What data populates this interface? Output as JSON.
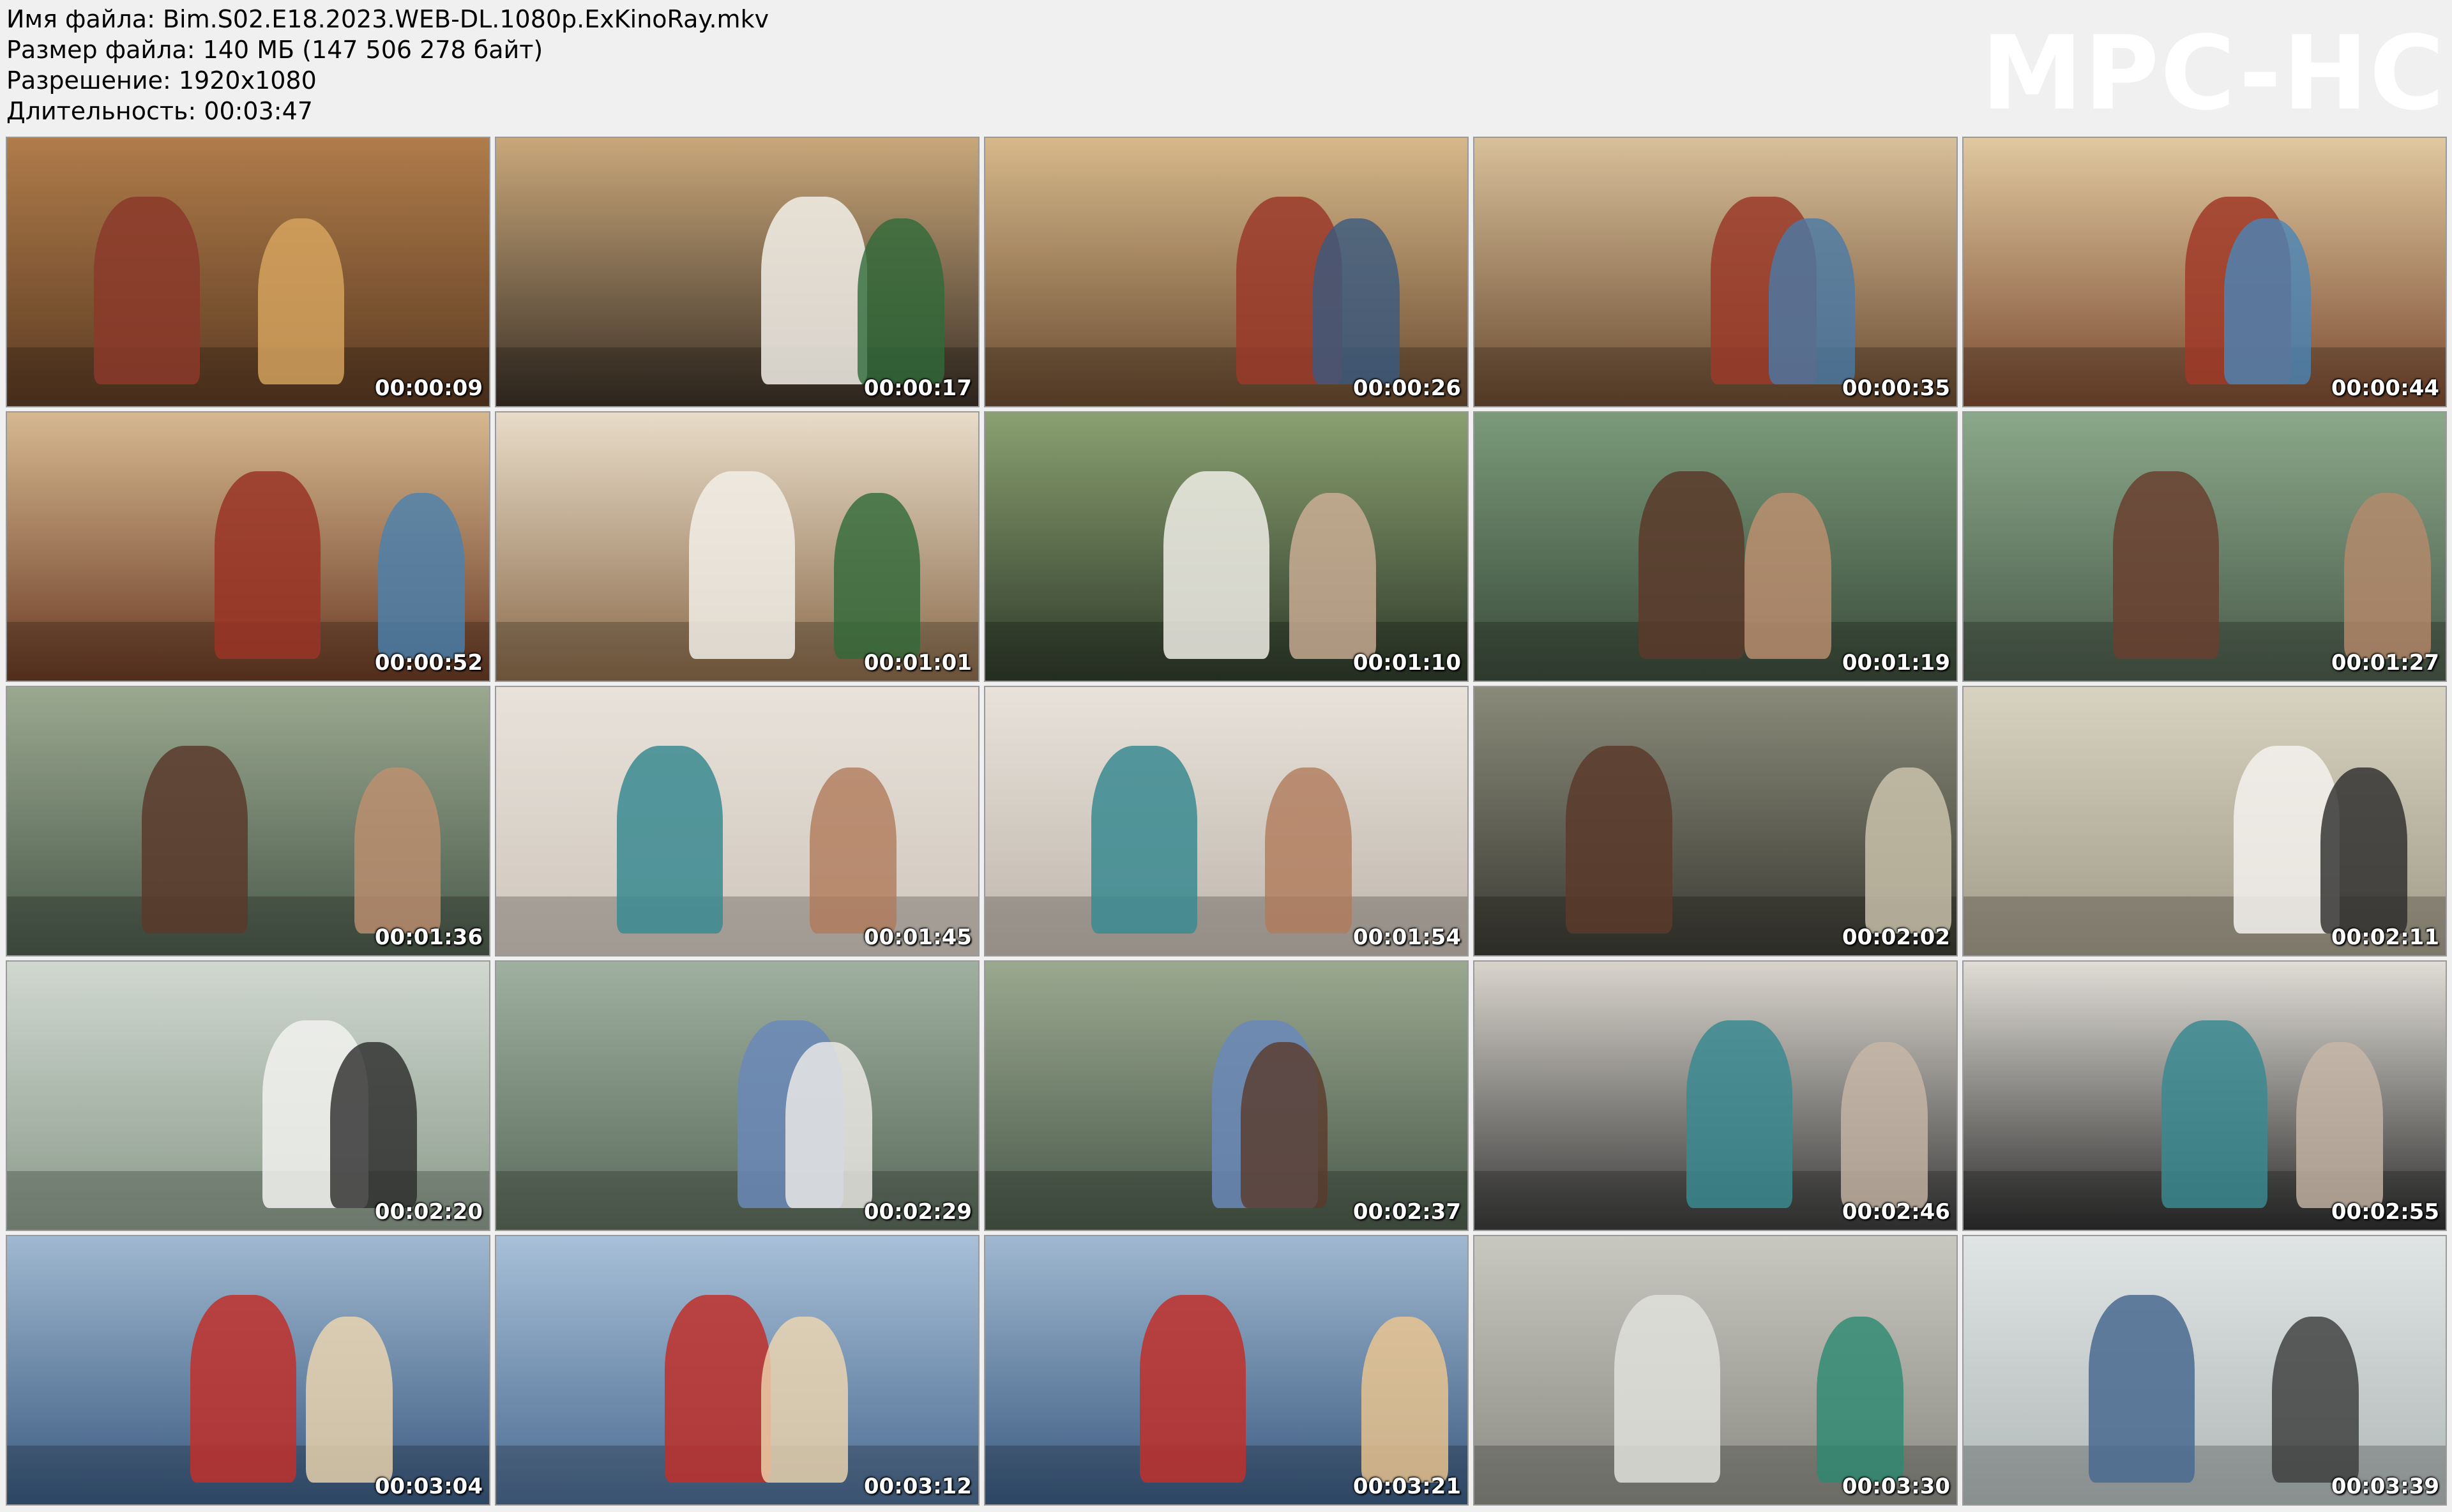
{
  "info": {
    "filename": "Имя файла: Bim.S02.E18.2023.WEB-DL.1080p.ExKinoRay.mkv",
    "filesize": "Размер файла: 140 МБ (147 506 278 байт)",
    "resolution": "Разрешение: 1920x1080",
    "duration": "Длительность: 00:03:47"
  },
  "brand": "MPC-HC",
  "thumbnails": [
    {
      "time": "00:00:09",
      "palette": [
        "#5a3a22",
        "#b07c4a",
        "#8b3a2a",
        "#d9a860"
      ]
    },
    {
      "time": "00:00:17",
      "palette": [
        "#3a3026",
        "#c9a77a",
        "#f2eee8",
        "#2f6a3a"
      ]
    },
    {
      "time": "00:00:26",
      "palette": [
        "#6a4a30",
        "#d6b88a",
        "#9a3a2a",
        "#3a5a80"
      ]
    },
    {
      "time": "00:00:35",
      "palette": [
        "#6a4a30",
        "#d8c09a",
        "#9a3a2a",
        "#4a7aa8"
      ]
    },
    {
      "time": "00:00:44",
      "palette": [
        "#7a4a30",
        "#e0c8a0",
        "#a03a28",
        "#4a86b8"
      ]
    },
    {
      "time": "00:00:52",
      "palette": [
        "#6a3a24",
        "#d6b890",
        "#9a3426",
        "#4a82b0"
      ]
    },
    {
      "time": "00:01:01",
      "palette": [
        "#8a6a4a",
        "#e8dcc8",
        "#f2efe8",
        "#2f6a3a"
      ]
    },
    {
      "time": "00:01:10",
      "palette": [
        "#2e3a2a",
        "#8aa070",
        "#f0ede6",
        "#d0b098"
      ]
    },
    {
      "time": "00:01:19",
      "palette": [
        "#3a4a3a",
        "#7a9a7a",
        "#5a3a2a",
        "#c09070"
      ]
    },
    {
      "time": "00:01:27",
      "palette": [
        "#4a5a4a",
        "#8aa88a",
        "#6a4030",
        "#b88a6a"
      ]
    },
    {
      "time": "00:01:36",
      "palette": [
        "#4a5a4a",
        "#9aa890",
        "#5a3a2a",
        "#c09070"
      ]
    },
    {
      "time": "00:01:45",
      "palette": [
        "#cfc6bc",
        "#e8e2da",
        "#3a8a90",
        "#b07a5a"
      ]
    },
    {
      "time": "00:01:54",
      "palette": [
        "#bfb6ac",
        "#e8e2da",
        "#3a8a90",
        "#b07a5a"
      ]
    },
    {
      "time": "00:02:02",
      "palette": [
        "#3a3a32",
        "#8a8a7a",
        "#5a3a2a",
        "#d0c8b0"
      ]
    },
    {
      "time": "00:02:11",
      "palette": [
        "#a09a88",
        "#d8d2c0",
        "#f4f2ee",
        "#2a2a2a"
      ]
    },
    {
      "time": "00:02:20",
      "palette": [
        "#8a9a8a",
        "#d0d8d0",
        "#f2f2f0",
        "#2a2a2a"
      ]
    },
    {
      "time": "00:02:29",
      "palette": [
        "#5a6a5a",
        "#a0b0a0",
        "#6a88b8",
        "#f0eeea"
      ]
    },
    {
      "time": "00:02:37",
      "palette": [
        "#4a5a4a",
        "#9aa890",
        "#6a88b8",
        "#5a3a2a"
      ]
    },
    {
      "time": "00:02:46",
      "palette": [
        "#3a3a3a",
        "#d8d4cc",
        "#3a8a90",
        "#c8b8a8"
      ]
    },
    {
      "time": "00:02:55",
      "palette": [
        "#2e2e2e",
        "#e0ddd6",
        "#3a8a90",
        "#c8b8a8"
      ]
    },
    {
      "time": "00:03:04",
      "palette": [
        "#3a5a80",
        "#a0b8d0",
        "#c0302a",
        "#f0d8b0"
      ]
    },
    {
      "time": "00:03:12",
      "palette": [
        "#4a6a90",
        "#a8c0d8",
        "#c0302a",
        "#f0d8b0"
      ]
    },
    {
      "time": "00:03:21",
      "palette": [
        "#3a5a80",
        "#a0b8d0",
        "#c0302a",
        "#f0c890"
      ]
    },
    {
      "time": "00:03:30",
      "palette": [
        "#8a8a82",
        "#c8c8c0",
        "#e0e0dc",
        "#2a8a70"
      ]
    },
    {
      "time": "00:03:39",
      "palette": [
        "#b0b8b8",
        "#e0e4e4",
        "#4a6a90",
        "#3a3a3a"
      ]
    }
  ]
}
